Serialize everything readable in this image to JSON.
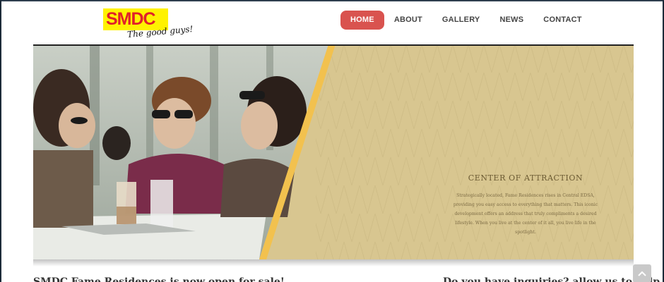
{
  "logo": {
    "brand": "SMDC",
    "tagline": "The good guys!"
  },
  "nav": {
    "items": [
      {
        "label": "HOME",
        "active": true
      },
      {
        "label": "ABOUT",
        "active": false
      },
      {
        "label": "GALLERY",
        "active": false
      },
      {
        "label": "NEWS",
        "active": false
      },
      {
        "label": "CONTACT",
        "active": false
      }
    ]
  },
  "hero": {
    "title": "CENTER OF ATTRACTION",
    "body": "Strategically located, Fame Residences rises in Central EDSA, providing you easy access to everything that matters. This iconic development offers an address that truly compliments a desired lifestyle. When you live at the center of it all, you live life in the spotlight.",
    "image_description": "three-women-at-cafe-photo"
  },
  "sections": {
    "left_heading": "SMDC Fame Residences is now open for sale!",
    "right_heading": "Do you have inquiries? allow us to help"
  },
  "colors": {
    "accent": "#d9534f",
    "hero_panel": "#d8c690",
    "hero_stripe": "#f2c14e",
    "logo_bg": "#fff200",
    "logo_text": "#e0202a"
  },
  "icons": {
    "scroll_top": "chevron-up-icon"
  }
}
